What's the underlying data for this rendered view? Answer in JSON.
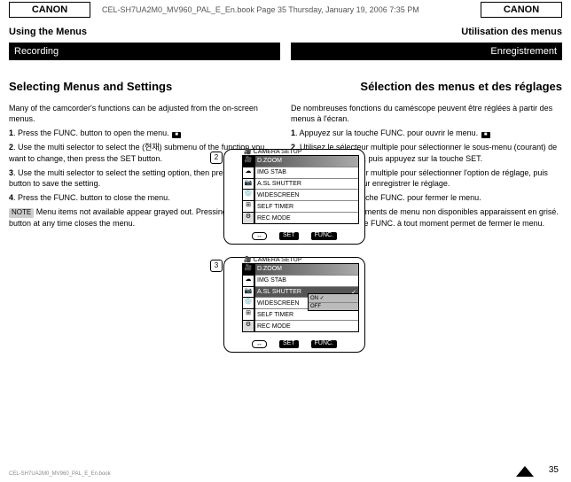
{
  "header": {
    "brand": "CANON",
    "page_label_left": "CEL-SH7UA2M0_MV960_PAL_E_En.book  Page 35  Thursday, January 19, 2006  7:35 PM",
    "page_label_right": ""
  },
  "chapter": {
    "left": "Using the Menus",
    "right": "Utilisation des menus"
  },
  "blackbar": {
    "left": "Recording",
    "right": "Enregistrement"
  },
  "section": {
    "left": "Selecting Menus and Settings",
    "right": "Sélection des menus et des réglages"
  },
  "left_col": {
    "intro": "Many of the camcorder's functions can be adjusted from the on-screen menus.",
    "step1_num": "1",
    "step1_txt": "Press the FUNC. button to open the menu.",
    "icon_hint": "camera icon",
    "step2_num": "2",
    "step2_txt": "Use the multi selector to select the (현재) submenu of the function you want to change, then press the SET button.",
    "step3_num": "3",
    "step3_txt": "Use the multi selector to select the setting option, then press the SET button to save the setting.",
    "step4_num": "4",
    "step4_txt": "Press the FUNC. button to close the menu.",
    "note_chip": "NOTE",
    "note_txt": "Menu items not available appear grayed out. Pressing the FUNC. button at any time closes the menu."
  },
  "right_col": {
    "intro": "De nombreuses fonctions du caméscope peuvent être réglées à partir des menus à l'écran.",
    "step1_num": "1",
    "step1_txt": "Appuyez sur la touche FUNC. pour ouvrir le menu.",
    "icon_hint": "icône caméra",
    "step2_num": "2",
    "step2_txt": "Utilisez le sélecteur multiple pour sélectionner le sous-menu (courant) de la fonction à modifier, puis appuyez sur la touche SET.",
    "step3_num": "3",
    "step3_txt": "Utilisez le sélecteur multiple pour sélectionner l'option de réglage, puis appuyez sur SET pour enregistrer le réglage.",
    "step4_num": "4",
    "step4_txt": "Appuyez sur la touche FUNC. pour fermer le menu.",
    "note_chip": "REMARQUE",
    "note_txt": "Les éléments de menu non disponibles apparaissent en grisé. Appuyer sur la touche FUNC. à tout moment permet de fermer le menu."
  },
  "screens": {
    "s1": {
      "badge": "2",
      "title": "CAMERA SETUP",
      "rows": [
        "D.ZOOM",
        "IMG STAB",
        "A.SL SHUTTER",
        "WIDESCREEN",
        "SELF TIMER",
        "REC MODE"
      ],
      "foot_left": "↔",
      "foot_mid": "SET",
      "foot_right": "FUNC."
    },
    "s2": {
      "badge": "3",
      "title": "CAMERA SETUP",
      "rows": [
        "D.ZOOM",
        "IMG STAB",
        "A.SL SHUTTER",
        "WIDESCREEN",
        "SELF TIMER",
        "REC MODE"
      ],
      "sel_row": "A.SL SHUTTER",
      "popup": [
        "ON ✓",
        "OFF"
      ],
      "foot_left": "↔",
      "foot_mid": "SET",
      "foot_right": "FUNC."
    }
  },
  "footer": {
    "pagenum": "35",
    "meta": "CEL-SH7UA2M0_MV960_PAL_E_En.book"
  }
}
